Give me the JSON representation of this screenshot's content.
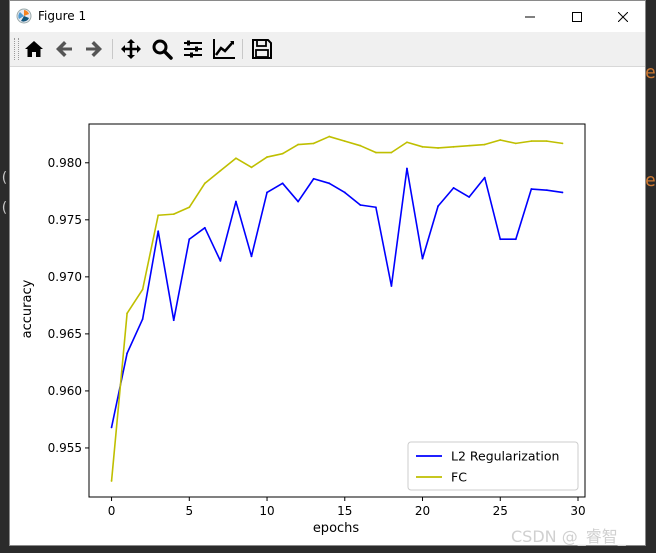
{
  "window": {
    "title": "Figure 1",
    "icon": "matplotlib-icon"
  },
  "window_controls": {
    "minimize_icon": "minimize-icon",
    "maximize_icon": "maximize-icon",
    "close_icon": "close-icon"
  },
  "toolbar": {
    "buttons": [
      {
        "icon": "home-icon",
        "name": "Home"
      },
      {
        "icon": "back-arrow-icon",
        "name": "Back"
      },
      {
        "icon": "forward-arrow-icon",
        "name": "Forward"
      },
      {
        "icon": "pan-icon",
        "name": "Pan"
      },
      {
        "icon": "zoom-icon",
        "name": "Zoom"
      },
      {
        "icon": "subplots-icon",
        "name": "Subplots"
      },
      {
        "icon": "edit-axis-icon",
        "name": "Customize"
      },
      {
        "icon": "save-icon",
        "name": "Save"
      }
    ]
  },
  "chart_data": {
    "type": "line",
    "title": "",
    "xlabel": "epochs",
    "ylabel": "accuracy",
    "xlim": [
      -1.45,
      30.45
    ],
    "ylim": [
      0.9507,
      0.9834
    ],
    "x_ticks": [
      0,
      5,
      10,
      15,
      20,
      25,
      30
    ],
    "y_ticks": [
      0.955,
      0.96,
      0.965,
      0.97,
      0.975,
      0.98
    ],
    "x_tick_labels": [
      "0",
      "5",
      "10",
      "15",
      "20",
      "25",
      "30"
    ],
    "y_tick_labels": [
      "0.955",
      "0.960",
      "0.965",
      "0.970",
      "0.975",
      "0.980"
    ],
    "grid": false,
    "legend_position": "lower-right",
    "x": [
      0,
      1,
      2,
      3,
      4,
      5,
      6,
      7,
      8,
      9,
      10,
      11,
      12,
      13,
      14,
      15,
      16,
      17,
      18,
      19,
      20,
      21,
      22,
      23,
      24,
      25,
      26,
      27,
      28,
      29
    ],
    "series": [
      {
        "name": "L2 Regularization",
        "color": "#0000ff",
        "values": [
          0.9568,
          0.9633,
          0.9663,
          0.974,
          0.9662,
          0.9733,
          0.9743,
          0.9714,
          0.9766,
          0.9718,
          0.9774,
          0.9782,
          0.9766,
          0.9786,
          0.9782,
          0.9774,
          0.9763,
          0.9761,
          0.9692,
          0.9795,
          0.9716,
          0.9762,
          0.9778,
          0.977,
          0.9787,
          0.9733,
          0.9733,
          0.9777,
          0.9776,
          0.9774
        ]
      },
      {
        "name": "FC",
        "color": "#bfbf00",
        "values": [
          0.9521,
          0.9668,
          0.9689,
          0.9754,
          0.9755,
          0.9761,
          0.9782,
          0.9793,
          0.9804,
          0.9796,
          0.9805,
          0.9808,
          0.9816,
          0.9817,
          0.9823,
          0.9819,
          0.9815,
          0.9809,
          0.9809,
          0.9818,
          0.9814,
          0.9813,
          0.9814,
          0.9815,
          0.9816,
          0.982,
          0.9817,
          0.9819,
          0.9819,
          0.9817
        ]
      }
    ]
  },
  "watermark": "CSDN @_睿智_"
}
